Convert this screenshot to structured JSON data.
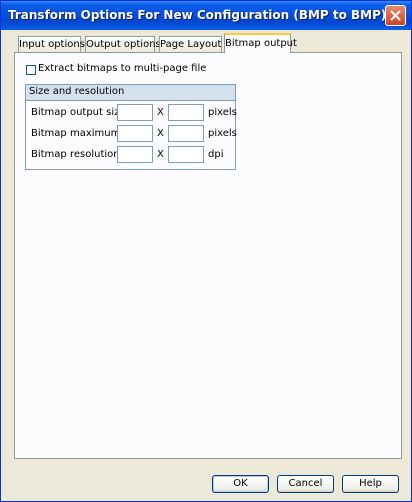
{
  "window": {
    "title": "Transform Options For New Configuration (BMP to BMP)"
  },
  "tabs": [
    {
      "label": "Input options"
    },
    {
      "label": "Output options"
    },
    {
      "label": "Page Layout"
    },
    {
      "label": "Bitmap output",
      "active": true
    }
  ],
  "extract": {
    "label": "Extract bitmaps to multi-page file",
    "checked": false
  },
  "size_group": {
    "title": "Size and resolution",
    "separator": "X",
    "rows": [
      {
        "label": "Bitmap output size:",
        "width": "",
        "height": "",
        "unit": "pixels"
      },
      {
        "label": "Bitmap maximum size:",
        "width": "",
        "height": "",
        "unit": "pixels"
      },
      {
        "label": "Bitmap resolution:",
        "width": "",
        "height": "",
        "unit": "dpi"
      }
    ]
  },
  "buttons": {
    "ok": "OK",
    "cancel": "Cancel",
    "help": "Help"
  },
  "colors": {
    "titlebar": "#0550de",
    "dialog_bg": "#ece9d8",
    "active_tab_accent": "#ffc83c",
    "group_header": "#d4e1ed"
  },
  "icons": {
    "close": "close-icon"
  }
}
